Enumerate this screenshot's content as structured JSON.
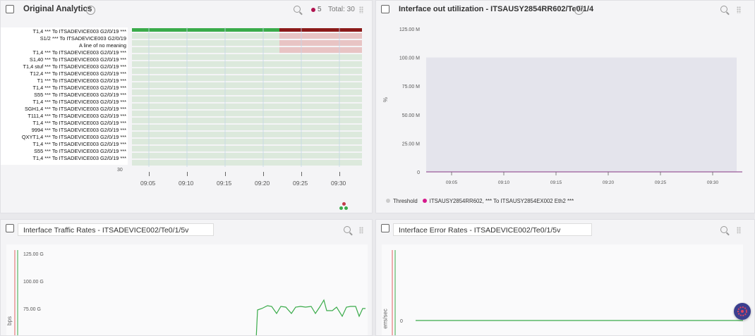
{
  "panels": {
    "analytics": {
      "title": "Original Analytics",
      "info": "i",
      "alert_count": "5",
      "total": "Total: 30",
      "rows": [
        "T1,4 *** To ITSADEVICE003 G2/0/19 ***",
        "S1/2 *** To ITSADEVICE003 G2/0/19",
        "A line of no meaning",
        "T1,4 *** To ITSADEVICE003 G2/0/19 ***",
        "S1,40 *** To ITSADEVICE003 G2/0/19 ***",
        "T1,4 stuf *** To ITSADEVICE003 G2/0/19 ***",
        "T12,4 *** To ITSADEVICE003 G2/0/19 ***",
        "T1 *** To ITSADEVICE003 G2/0/19 ***",
        "T1,4 *** To ITSADEVICE003 G2/0/19 ***",
        "S55 *** To ITSADEVICE003 G2/0/19 ***",
        "T1,4 *** To ITSADEVICE003 G2/0/19 ***",
        "SGH1,4 *** To ITSADEVICE003 G2/0/19 ***",
        "T111,4 *** To ITSADEVICE003 G2/0/19 ***",
        "T1,4 *** To ITSADEVICE003 G2/0/19 ***",
        "9994 *** To ITSADEVICE003 G2/0/19 ***",
        "QXYT1,4 *** To ITSADEVICE003 G2/0/19 ***",
        "T1,4 *** To ITSADEVICE003 G2/0/19 ***",
        "S55 *** To ITSADEVICE003 G2/0/19 ***",
        "T1,4 *** To ITSADEVICE003 G2/0/19 ***"
      ],
      "y_extra": "30",
      "x_ticks": [
        "09:05",
        "09:10",
        "09:15",
        "09:20",
        "09:25",
        "09:30"
      ],
      "colors": {
        "up": "#3aab4a",
        "down": "#8b1a1a",
        "row_bg": "#dce9dc",
        "row_down": "#e8c4c4"
      }
    },
    "utilization": {
      "title": "Interface out utilization - ITSAUSY2854RR602/Te0/1/4",
      "info": "i",
      "ylabel": "%",
      "y_ticks": [
        "125.00 M",
        "100.00 M",
        "75.00 M",
        "50.00 M",
        "25.00 M",
        "0"
      ],
      "x_ticks": [
        "09:05",
        "09:10",
        "09:15",
        "09:20",
        "09:25",
        "09:30"
      ],
      "legend": [
        {
          "label": "Threshold",
          "color": "#cccccc"
        },
        {
          "label": "ITSAUSY2854RR602, *** To ITSAUSY2854EX002 Eth2 ***",
          "color": "#d6198c"
        }
      ],
      "colors": {
        "area": "#e4e4ec",
        "line": "#9a5a9a"
      }
    },
    "traffic": {
      "title": "Interface Traffic Rates - ITSADEVICE002/Te0/1/5v",
      "ylabel": "bps",
      "y_ticks": [
        "125.00 G",
        "100.00 G",
        "75.00 G"
      ],
      "colors": {
        "line": "#3aab4a",
        "left_red": "#e06060",
        "left_green": "#3aab4a"
      }
    },
    "errors": {
      "title": "Interface Error Rates - ITSADEVICE002/Te0/1/5v",
      "ylabel": "errs/sec",
      "y_ticks": [
        "0"
      ],
      "colors": {
        "line": "#3aab4a",
        "left_red": "#e06060"
      }
    }
  },
  "chat_widget": {
    "icon": "chat-bubble-icon",
    "color": "#3b3f8f"
  }
}
